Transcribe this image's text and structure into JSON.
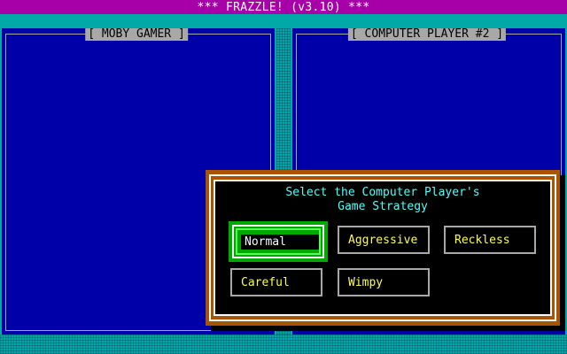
{
  "window": {
    "title": "*** FRAZZLE! (v3.10) ***"
  },
  "players": [
    {
      "label": "[ MOBY GAMER ]"
    },
    {
      "label": "[ COMPUTER PLAYER #2 ]"
    }
  ],
  "dialog": {
    "title_line1": "Select the Computer Player's",
    "title_line2": "Game Strategy",
    "options": [
      {
        "label": "Normal",
        "selected": true
      },
      {
        "label": "Aggressive",
        "selected": false
      },
      {
        "label": "Reckless",
        "selected": false
      },
      {
        "label": "Careful",
        "selected": false
      },
      {
        "label": "Wimpy",
        "selected": false
      }
    ]
  },
  "colors": {
    "title_bar": "#a800a8",
    "panel": "#0000a8",
    "desktop": "#00a8a8",
    "dialog_border": "#a85400",
    "dialog_title_text": "#54fcfc",
    "option_text": "#fcfc54",
    "selected_bg": "#00a800"
  }
}
